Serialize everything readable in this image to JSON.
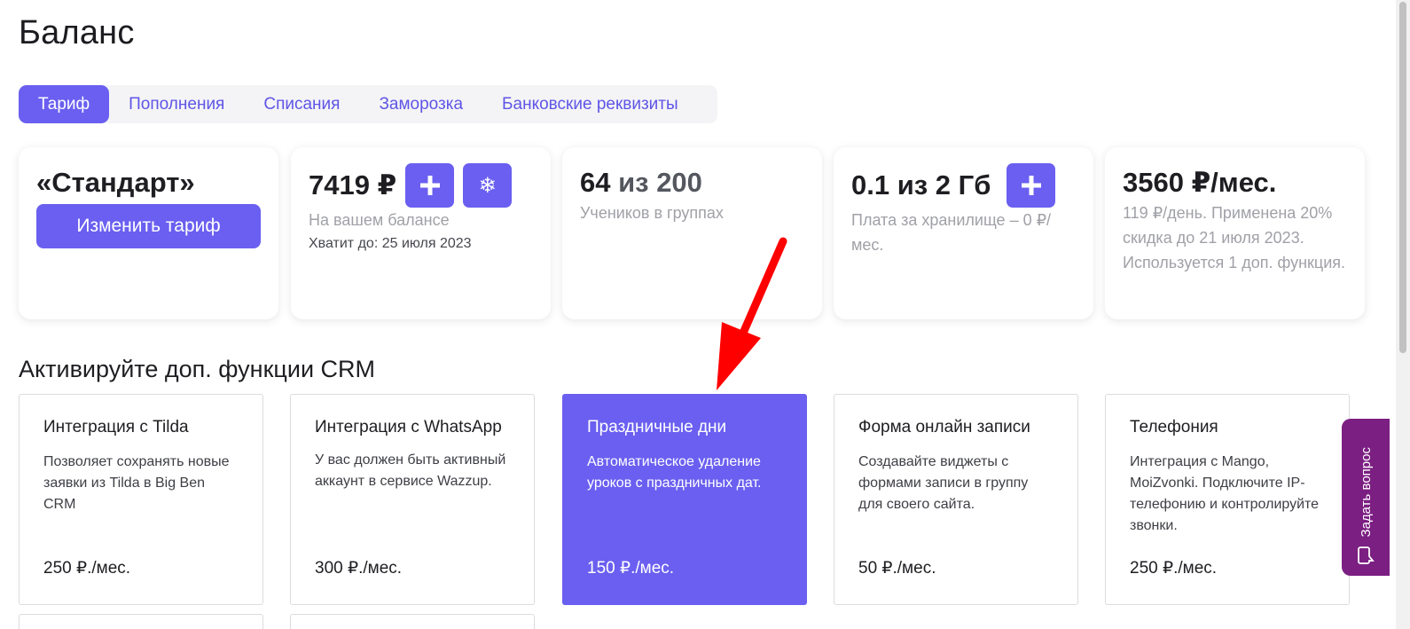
{
  "page": {
    "title": "Баланс"
  },
  "tabs": [
    {
      "label": "Тариф",
      "active": true
    },
    {
      "label": "Пополнения"
    },
    {
      "label": "Списания"
    },
    {
      "label": "Заморозка"
    },
    {
      "label": "Банковские реквизиты"
    }
  ],
  "cards": {
    "plan": {
      "name": "«Стандарт»",
      "button": "Изменить тариф"
    },
    "balance": {
      "amount": "7419 ₽",
      "label": "На вашем балансе",
      "until": "Хватит до: 25 июля 2023",
      "add_icon": "plus-icon",
      "freeze_icon": "snowflake-icon"
    },
    "students": {
      "count": "64",
      "of_total": "из 200",
      "label": "Учеников в группах"
    },
    "storage": {
      "value": "0.1 из 2 Гб",
      "label": "Плата за хранилище – 0 ₽/мес.",
      "add_icon": "plus-icon"
    },
    "monthly": {
      "amount": "3560 ₽/мес.",
      "note": "119 ₽/день. Применена 20% скидка до 21 июля 2023. Используется 1 доп. функция."
    }
  },
  "features_section": {
    "title": "Активируйте доп. функции CRM"
  },
  "features": [
    {
      "title": "Интеграция с Tilda",
      "desc": "Позволяет сохранять новые заявки из Tilda в Big Ben CRM",
      "price": "250 ₽./мес."
    },
    {
      "title": "Интеграция с WhatsApp",
      "desc": "У вас должен быть активный аккаунт в сервисе Wazzup.",
      "price": "300 ₽./мес."
    },
    {
      "title": "Праздничные дни",
      "desc": "Автоматическое удаление уроков с праздничных дат.",
      "price": "150 ₽./мес."
    },
    {
      "title": "Форма онлайн записи",
      "desc": "Создавайте виджеты с формами записи в группу для своего сайта.",
      "price": "50 ₽./мес."
    },
    {
      "title": "Телефония",
      "desc": "Интеграция с Mango, MoiZvonki. Подключите IP-телефонию и контролируйте звонки.",
      "price": "250 ₽./мес."
    }
  ],
  "help_widget": {
    "label": "Задать вопрос",
    "icon": "chat-bubble-icon"
  },
  "colors": {
    "accent": "#6a5ff0",
    "help": "#7b1f82",
    "arrow": "#ff0000"
  }
}
